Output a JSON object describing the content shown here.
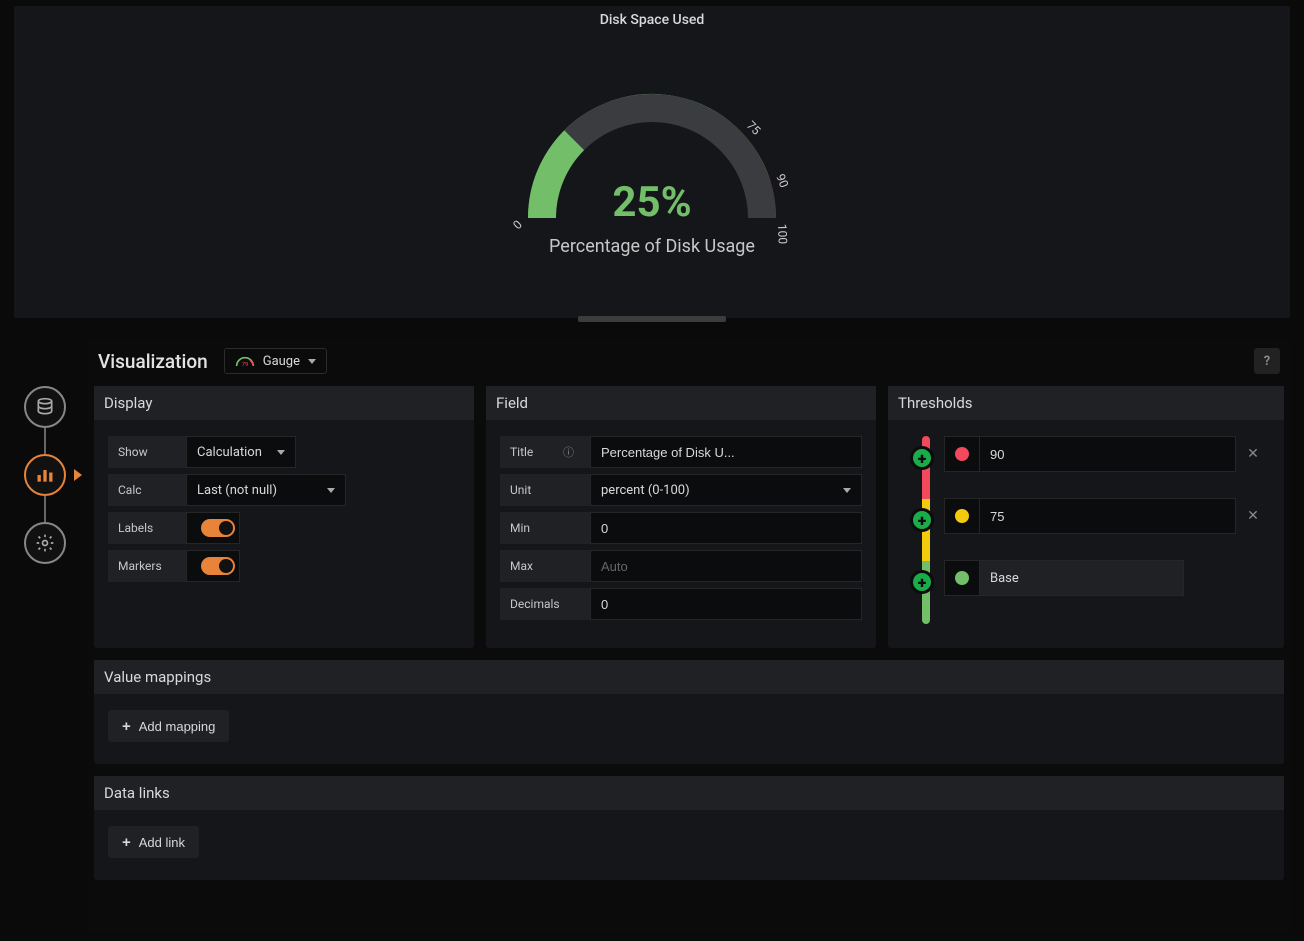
{
  "preview": {
    "title": "Disk Space Used",
    "value_display": "25%",
    "subtitle": "Percentage of Disk Usage",
    "ticks": {
      "min": "0",
      "t1": "75",
      "t2": "90",
      "max": "100"
    }
  },
  "chart_data": {
    "type": "gauge",
    "title": "Disk Space Used",
    "subtitle": "Percentage of Disk Usage",
    "value": 25,
    "unit": "percent (0-100)",
    "min": 0,
    "max": 100,
    "decimals": 0,
    "ticks": [
      0,
      75,
      90,
      100
    ],
    "thresholds": [
      {
        "label": "Base",
        "color": "#73bf69",
        "from": 0
      },
      {
        "label": "75",
        "color": "#f2cc0c",
        "from": 75
      },
      {
        "label": "90",
        "color": "#f2495c",
        "from": 90
      }
    ]
  },
  "visualization": {
    "header": "Visualization",
    "type_label": "Gauge"
  },
  "display": {
    "header": "Display",
    "show_label": "Show",
    "show_value": "Calculation",
    "calc_label": "Calc",
    "calc_value": "Last (not null)",
    "labels_label": "Labels",
    "markers_label": "Markers"
  },
  "field": {
    "header": "Field",
    "title_label": "Title",
    "title_value": "Percentage of Disk U...",
    "unit_label": "Unit",
    "unit_value": "percent (0-100)",
    "min_label": "Min",
    "min_value": "0",
    "max_label": "Max",
    "max_placeholder": "Auto",
    "decimals_label": "Decimals",
    "decimals_value": "0"
  },
  "thresholds": {
    "header": "Thresholds",
    "rows": [
      {
        "value": "90",
        "color": "#f2495c"
      },
      {
        "value": "75",
        "color": "#f2cc0c"
      }
    ],
    "base_label": "Base",
    "base_color": "#73bf69"
  },
  "value_mappings": {
    "header": "Value mappings",
    "add_label": "Add mapping"
  },
  "data_links": {
    "header": "Data links",
    "add_label": "Add link"
  },
  "colors": {
    "green": "#73bf69",
    "yellow": "#f2cc0c",
    "red": "#f2495c",
    "orange": "#e8833a",
    "track": "#3a3c40"
  }
}
